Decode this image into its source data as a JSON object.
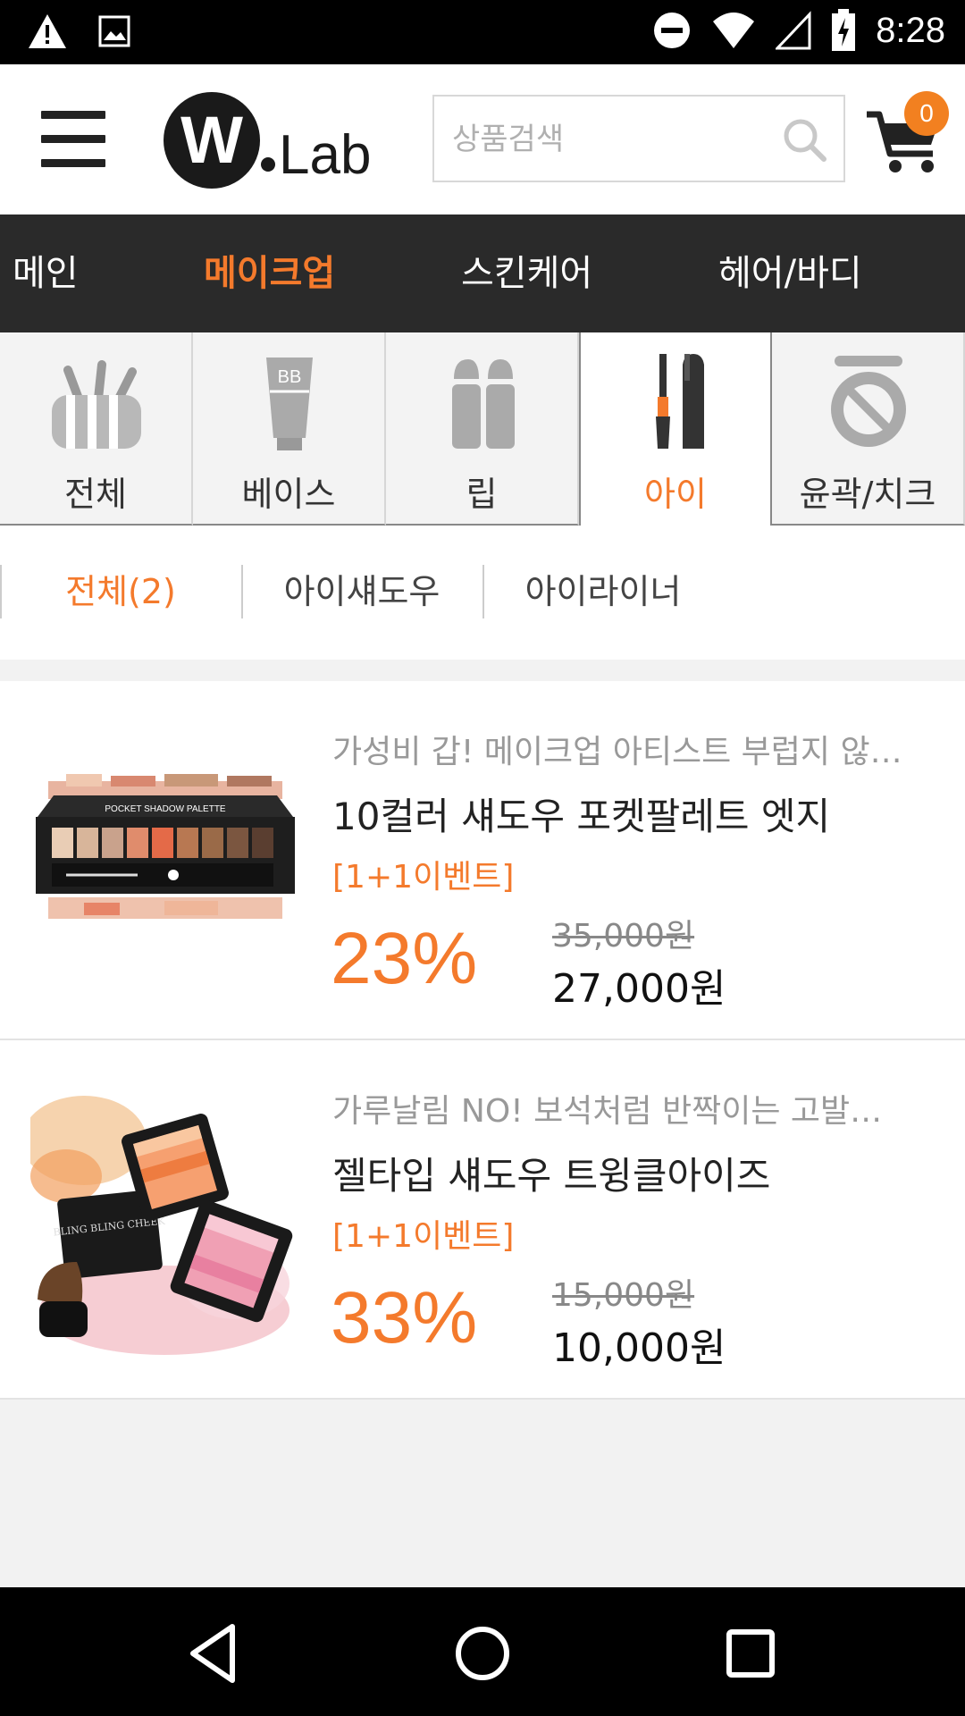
{
  "status_bar": {
    "time": "8:28"
  },
  "header": {
    "logo_alt": "W.Lab",
    "search_placeholder": "상품검색",
    "cart_count": "0"
  },
  "main_nav": {
    "tabs": [
      {
        "label": "메인",
        "active": false
      },
      {
        "label": "메이크업",
        "active": true
      },
      {
        "label": "스킨케어",
        "active": false
      },
      {
        "label": "헤어/바디",
        "active": false
      }
    ]
  },
  "categories": [
    {
      "label": "전체",
      "icon": "all-makeup-icon",
      "active": false
    },
    {
      "label": "베이스",
      "icon": "bb-tube-icon",
      "active": false
    },
    {
      "label": "립",
      "icon": "lipstick-icon",
      "active": false
    },
    {
      "label": "아이",
      "icon": "mascara-icon",
      "active": true
    },
    {
      "label": "윤곽/치크",
      "icon": "compact-icon",
      "active": false
    }
  ],
  "sub_tabs": [
    {
      "label": "전체(2)",
      "active": true
    },
    {
      "label": "아이섀도우",
      "active": false
    },
    {
      "label": "아이라이너",
      "active": false
    }
  ],
  "products": [
    {
      "promo": "가성비 갑! 메이크업 아티스트 부럽지 않…",
      "name": "10컬러 섀도우 포켓팔레트 엣지",
      "event": "[1+1이벤트]",
      "discount": "23%",
      "original_price": "35,000원",
      "price": "27,000원",
      "image_text": "POCKET SHADOW PALETTE"
    },
    {
      "promo": "가루날림 NO! 보석처럼 반짝이는 고발…",
      "name": "젤타입 섀도우 트윙클아이즈",
      "event": "[1+1이벤트]",
      "discount": "33%",
      "original_price": "15,000원",
      "price": "10,000원",
      "image_text": "BLING BLING CHEEK"
    }
  ],
  "colors": {
    "accent": "#f47a2c",
    "nav_bg": "#2a2a2a",
    "badge": "#f28020"
  }
}
